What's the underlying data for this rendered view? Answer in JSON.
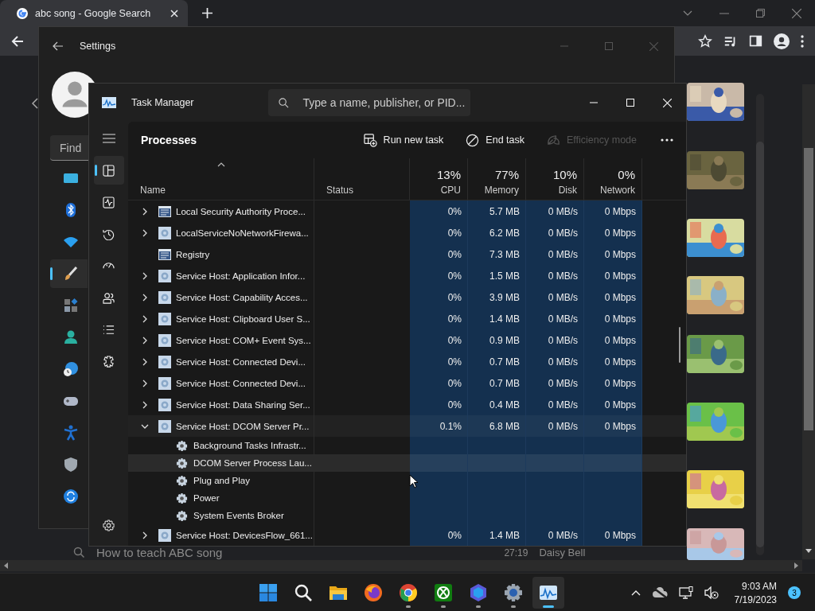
{
  "browser": {
    "tab_title": "abc song - Google Search",
    "result": {
      "title": "How to teach ABC song",
      "duration": "27:19",
      "channel": "Daisy Bell"
    }
  },
  "settings": {
    "title": "Settings",
    "search_placeholder": "Find",
    "nav": [
      {
        "selected": false
      },
      {
        "selected": false
      },
      {
        "selected": false
      },
      {
        "selected": true
      },
      {
        "selected": false
      },
      {
        "selected": false
      },
      {
        "selected": false
      },
      {
        "selected": false
      },
      {
        "selected": false
      },
      {
        "selected": false
      },
      {
        "selected": false
      }
    ]
  },
  "task_manager": {
    "title": "Task Manager",
    "search_placeholder": "Type a name, publisher, or PID...",
    "nav": [
      {
        "selected": true
      },
      {
        "selected": false
      },
      {
        "selected": false
      },
      {
        "selected": false
      },
      {
        "selected": false
      },
      {
        "selected": false
      },
      {
        "selected": false
      }
    ],
    "page_title": "Processes",
    "actions": [
      {
        "kind": "run",
        "label": "Run new task",
        "disabled": false
      },
      {
        "kind": "end",
        "label": "End task",
        "disabled": false
      },
      {
        "kind": "efficiency",
        "label": "Efficiency mode",
        "disabled": true
      }
    ],
    "columns": [
      {
        "label": "Name",
        "sorted": true
      },
      {
        "label": "Status",
        "sorted": false
      },
      {
        "usage": "13%",
        "label": "CPU",
        "sorted": false
      },
      {
        "usage": "77%",
        "label": "Memory",
        "sorted": false
      },
      {
        "usage": "10%",
        "label": "Disk",
        "sorted": false
      },
      {
        "usage": "0%",
        "label": "Network",
        "sorted": false
      }
    ],
    "rows": [
      {
        "name": "Local Security Authority Proce...",
        "kind": "window",
        "has_children": true,
        "expanded": false,
        "cpu": "0%",
        "memory": "5.7 MB",
        "disk": "0 MB/s",
        "network": "0 Mbps"
      },
      {
        "name": "LocalServiceNoNetworkFirewa...",
        "kind": "service",
        "has_children": true,
        "expanded": false,
        "cpu": "0%",
        "memory": "6.2 MB",
        "disk": "0 MB/s",
        "network": "0 Mbps"
      },
      {
        "name": "Registry",
        "kind": "window",
        "has_children": false,
        "cpu": "0%",
        "memory": "7.3 MB",
        "disk": "0 MB/s",
        "network": "0 Mbps"
      },
      {
        "name": "Service Host: Application Infor...",
        "kind": "service",
        "has_children": true,
        "expanded": false,
        "cpu": "0%",
        "memory": "1.5 MB",
        "disk": "0 MB/s",
        "network": "0 Mbps"
      },
      {
        "name": "Service Host: Capability Acces...",
        "kind": "service",
        "has_children": true,
        "expanded": false,
        "cpu": "0%",
        "memory": "3.9 MB",
        "disk": "0 MB/s",
        "network": "0 Mbps"
      },
      {
        "name": "Service Host: Clipboard User S...",
        "kind": "service",
        "has_children": true,
        "expanded": false,
        "cpu": "0%",
        "memory": "1.4 MB",
        "disk": "0 MB/s",
        "network": "0 Mbps"
      },
      {
        "name": "Service Host: COM+ Event Sys...",
        "kind": "service",
        "has_children": true,
        "expanded": false,
        "cpu": "0%",
        "memory": "0.9 MB",
        "disk": "0 MB/s",
        "network": "0 Mbps"
      },
      {
        "name": "Service Host: Connected Devi...",
        "kind": "service",
        "has_children": true,
        "expanded": false,
        "cpu": "0%",
        "memory": "0.7 MB",
        "disk": "0 MB/s",
        "network": "0 Mbps"
      },
      {
        "name": "Service Host: Connected Devi...",
        "kind": "service",
        "has_children": true,
        "expanded": false,
        "cpu": "0%",
        "memory": "0.7 MB",
        "disk": "0 MB/s",
        "network": "0 Mbps"
      },
      {
        "name": "Service Host: Data Sharing Ser...",
        "kind": "service",
        "has_children": true,
        "expanded": false,
        "cpu": "0%",
        "memory": "0.4 MB",
        "disk": "0 MB/s",
        "network": "0 Mbps"
      },
      {
        "name": "Service Host: DCOM Server Pr...",
        "kind": "service",
        "has_children": true,
        "expanded": true,
        "cpu": "0.1%",
        "memory": "6.8 MB",
        "disk": "0 MB/s",
        "network": "0 Mbps",
        "children": [
          {
            "name": "Background Tasks Infrastr...",
            "hovered": false
          },
          {
            "name": "DCOM Server Process Lau...",
            "hovered": true
          },
          {
            "name": "Plug and Play",
            "hovered": false
          },
          {
            "name": "Power",
            "hovered": false
          },
          {
            "name": "System Events Broker",
            "hovered": false
          }
        ]
      },
      {
        "name": "Service Host: DevicesFlow_661...",
        "kind": "service",
        "has_children": true,
        "expanded": false,
        "cpu": "0%",
        "memory": "1.4 MB",
        "disk": "0 MB/s",
        "network": "0 Mbps"
      }
    ]
  },
  "taskbar": {
    "apps": [
      {
        "kind": "start",
        "running": false,
        "selected": false
      },
      {
        "kind": "search",
        "running": false,
        "selected": false
      },
      {
        "kind": "folder",
        "running": false,
        "selected": false
      },
      {
        "kind": "firefox",
        "running": false,
        "selected": false
      },
      {
        "kind": "chrome",
        "running": true,
        "selected": false
      },
      {
        "kind": "xbox",
        "running": true,
        "selected": false
      },
      {
        "kind": "hexagon",
        "running": true,
        "selected": false
      },
      {
        "kind": "settings",
        "running": true,
        "selected": false
      },
      {
        "kind": "taskmanager",
        "running": true,
        "selected": true
      }
    ],
    "time": "9:03 AM",
    "date": "7/19/2023",
    "notifications": "3"
  }
}
